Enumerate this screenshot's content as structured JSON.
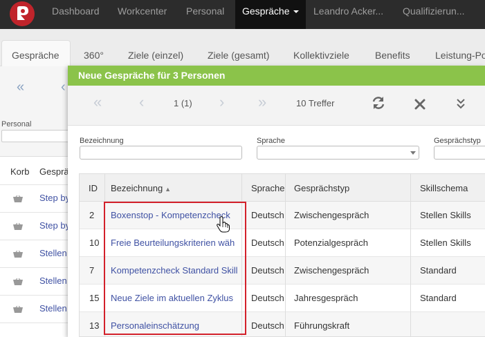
{
  "navbar": {
    "items": [
      {
        "label": "Dashboard"
      },
      {
        "label": "Workcenter"
      },
      {
        "label": "Personal"
      },
      {
        "label": "Gespräche"
      },
      {
        "label": "Leandro Acker..."
      },
      {
        "label": "Qualifizierun..."
      }
    ]
  },
  "tabs": [
    {
      "label": "Gespräche"
    },
    {
      "label": "360°"
    },
    {
      "label": "Ziele (einzel)"
    },
    {
      "label": "Ziele (gesamt)"
    },
    {
      "label": "Kollektivziele"
    },
    {
      "label": "Benefits"
    },
    {
      "label": "Leistung-Po"
    }
  ],
  "background": {
    "filter_label": "Personal",
    "columns": [
      "Korb",
      "Gesprä"
    ],
    "rows": [
      "Step by",
      "Step by",
      "Stellen",
      "Stellen",
      "Stellen"
    ]
  },
  "modal": {
    "title": "Neue Gespräche für 3 Personen",
    "pager": {
      "page_info": "1 (1)",
      "hits": "10 Treffer"
    },
    "filters": {
      "bezeichnung_label": "Bezeichnung",
      "sprache_label": "Sprache",
      "gespraechstyp_label": "Gesprächstyp"
    },
    "columns": {
      "id": "ID",
      "bezeichnung": "Bezeichnung",
      "sprache": "Sprache",
      "typ": "Gesprächstyp",
      "skill": "Skillschema"
    },
    "rows": [
      {
        "id": "2",
        "bezeichnung": "Boxenstop - Kompetenzcheck",
        "sprache": "Deutsch",
        "typ": "Zwischengespräch",
        "skill": "Stellen Skills"
      },
      {
        "id": "10",
        "bezeichnung": "Freie Beurteilungskriterien wäh",
        "sprache": "Deutsch",
        "typ": "Potenzialgespräch",
        "skill": "Stellen Skills"
      },
      {
        "id": "7",
        "bezeichnung": "Kompetenzcheck Standard Skill",
        "sprache": "Deutsch",
        "typ": "Zwischengespräch",
        "skill": "Standard"
      },
      {
        "id": "15",
        "bezeichnung": "Neue Ziele im aktuellen Zyklus",
        "sprache": "Deutsch",
        "typ": "Jahresgespräch",
        "skill": "Standard"
      },
      {
        "id": "13",
        "bezeichnung": "Personaleinschätzung",
        "sprache": "Deutsch",
        "typ": "Führungskraft",
        "skill": ""
      }
    ]
  },
  "colors": {
    "header_green": "#8bc34a",
    "link_blue": "#3f51a3",
    "highlight_red": "#d3202a",
    "navbar": "#2c2c2c"
  }
}
